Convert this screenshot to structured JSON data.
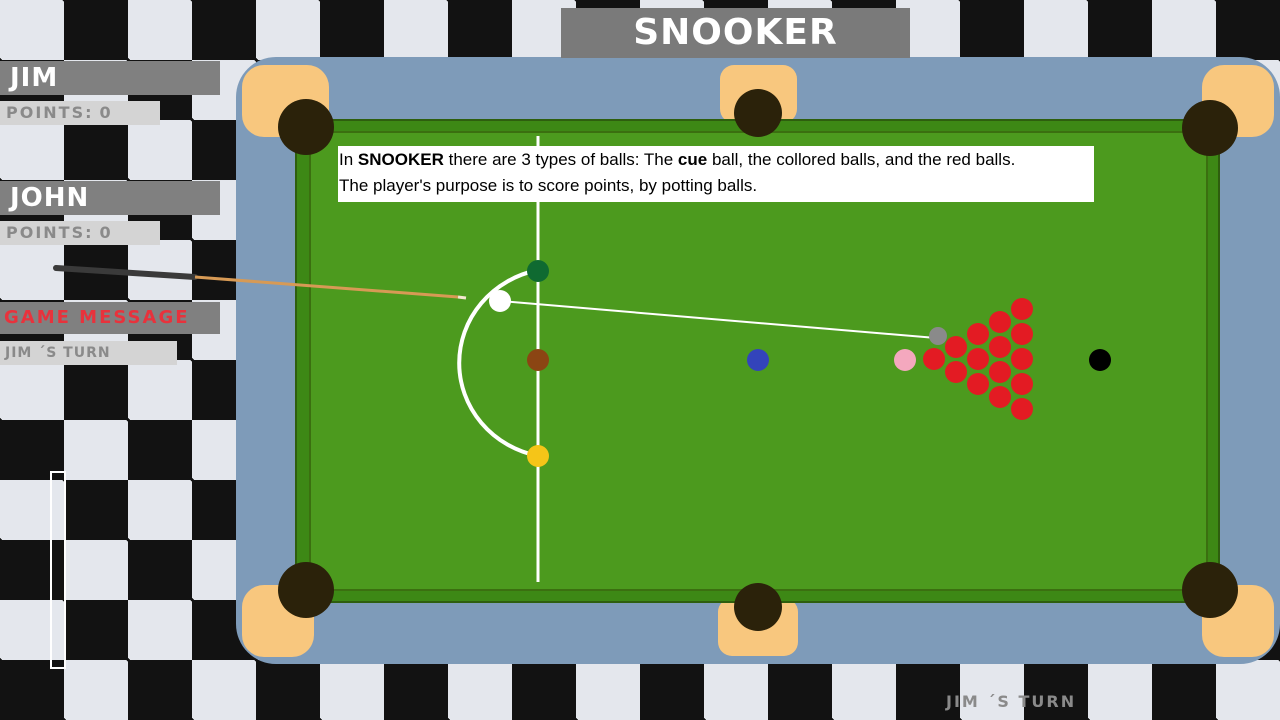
{
  "title": "SNOOKER",
  "players": [
    {
      "name": "JIM",
      "points_label": "POINTS:",
      "points": "0"
    },
    {
      "name": "JOHN",
      "points_label": "POINTS:",
      "points": "0"
    }
  ],
  "game_message": {
    "label": "GAME MESSAGE",
    "text": "JIM ´S TURN"
  },
  "bottom_turn": "JIM ´S TURN",
  "info": {
    "line1_a": "In ",
    "line1_b": "SNOOKER",
    "line1_c": " there are 3 types of balls: The ",
    "line1_d": "cue",
    "line1_e": " ball, the collored balls, and the red balls.",
    "line2": "The player's purpose is to score points, by potting balls."
  },
  "shot_power": 0,
  "colors": {
    "cloth": "#4c9a1e",
    "rail": "#7e9bb9",
    "pocket": "#2b220a",
    "pocket_plate": "#f8c77e",
    "message_accent": "#e8323c"
  },
  "balls": [
    {
      "name": "cue",
      "color": "#ffffff"
    },
    {
      "name": "green",
      "color": "#0f6a31"
    },
    {
      "name": "brown",
      "color": "#8b4513"
    },
    {
      "name": "yellow",
      "color": "#f5c518"
    },
    {
      "name": "blue",
      "color": "#3344bb"
    },
    {
      "name": "pink",
      "color": "#f4a8be"
    },
    {
      "name": "black",
      "color": "#000000"
    },
    {
      "name": "red",
      "color": "#e31b23",
      "count": 15
    }
  ]
}
